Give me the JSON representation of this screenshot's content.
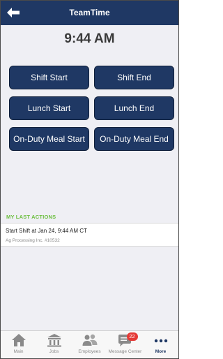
{
  "header": {
    "title": "TeamTime",
    "back_icon": "back-arrow-icon"
  },
  "clock": {
    "time": "9:44 AM"
  },
  "buttons": {
    "shift_start": "Shift Start",
    "shift_end": "Shift End",
    "lunch_start": "Lunch Start",
    "lunch_end": "Lunch End",
    "meal_start": "On-Duty Meal Start",
    "meal_end": "On-Duty Meal End"
  },
  "last_actions": {
    "heading": "MY LAST ACTIONS",
    "items": [
      {
        "title": "Start Shift at Jan 24, 9:44 AM CT",
        "subtitle": "Ag Processing Inc. #10532"
      }
    ]
  },
  "tabbar": {
    "tabs": [
      {
        "label": "Main",
        "icon": "home-icon"
      },
      {
        "label": "Jobs",
        "icon": "building-icon"
      },
      {
        "label": "Employees",
        "icon": "people-icon"
      },
      {
        "label": "Message Center",
        "icon": "chat-icon",
        "badge": "22"
      },
      {
        "label": "More",
        "icon": "more-dots-icon",
        "active": true
      }
    ]
  },
  "colors": {
    "primary": "#1f3864",
    "accent_green": "#6cbf3f",
    "badge_red": "#e53935",
    "background": "#efeff4"
  }
}
